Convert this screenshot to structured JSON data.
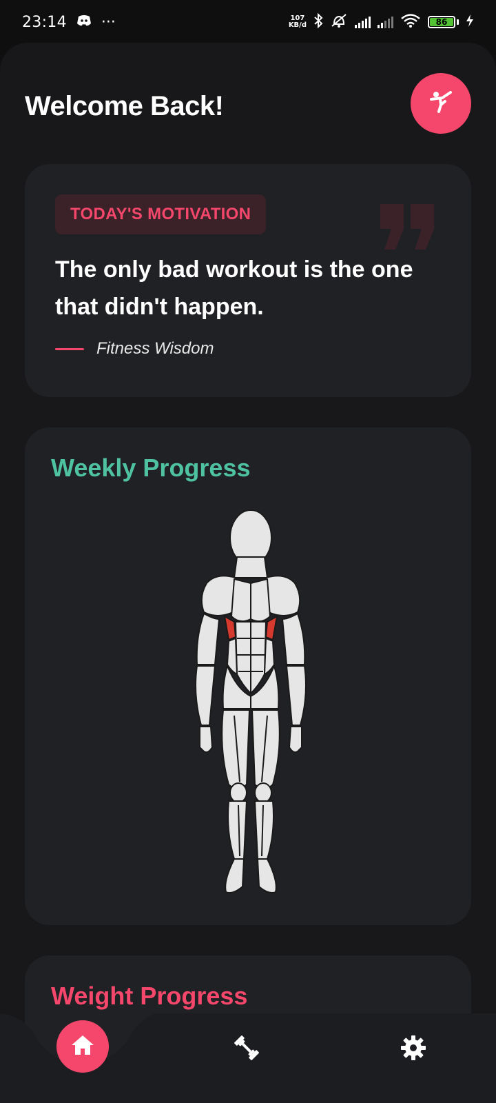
{
  "status_bar": {
    "time": "23:14",
    "more_indicator": "···",
    "net_speed_value": "107",
    "net_speed_unit": "KB/d",
    "battery_level": "86",
    "icons": [
      "discord-icon",
      "bluetooth-icon",
      "alarm-off-icon",
      "signal-icon",
      "signal-icon",
      "wifi-icon",
      "battery-icon",
      "charging-icon"
    ]
  },
  "header": {
    "title": "Welcome Back!",
    "profile_icon": "martial-arts-kick-icon"
  },
  "motivation": {
    "tag": "TODAY'S MOTIVATION",
    "quote": "The only bad workout is the one that didn't happen.",
    "author": "Fitness Wisdom"
  },
  "weekly_progress": {
    "title": "Weekly Progress",
    "highlighted_muscles": [
      "serratus"
    ]
  },
  "weight_progress": {
    "title": "Weight Progress"
  },
  "bottom_nav": {
    "items": [
      {
        "icon": "home-icon",
        "active": true
      },
      {
        "icon": "dumbbell-icon",
        "active": false
      },
      {
        "icon": "gear-icon",
        "active": false
      }
    ]
  },
  "colors": {
    "accent": "#f4476b",
    "progress_title": "#4fc3a1",
    "card_bg": "#202124",
    "panel_bg": "#18181a",
    "muscle_highlight": "#d63a2f"
  }
}
